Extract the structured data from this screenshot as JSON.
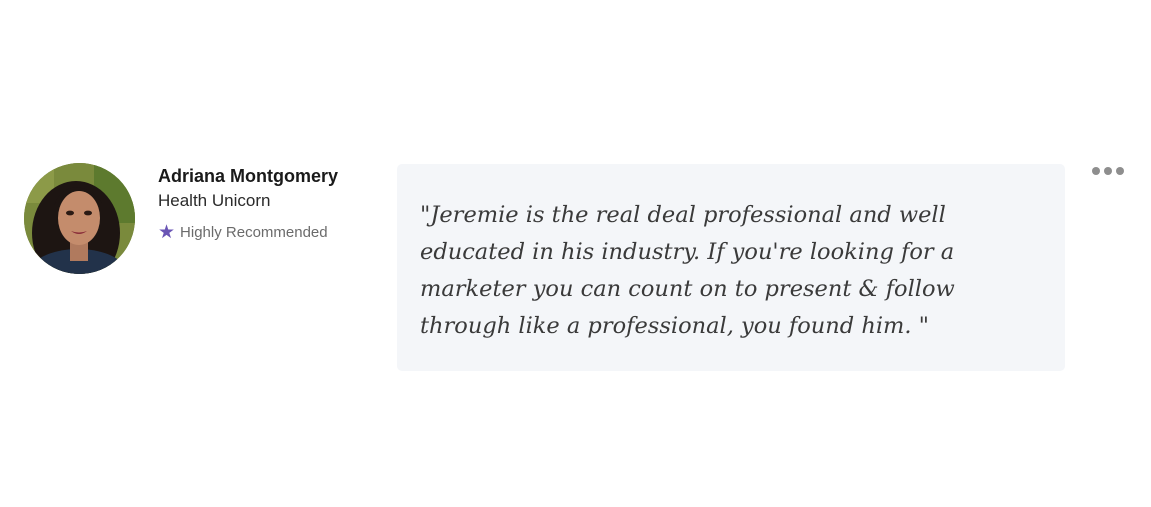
{
  "testimonial": {
    "author_name": "Adriana Montgomery",
    "author_company": "Health Unicorn",
    "badge_label": "Highly Recommended",
    "badge_icon": "star-icon",
    "quote": "\"Jeremie is the real deal professional and well educated in his industry. If you're looking for a marketer you can count on to present & follow through like a professional, you found him. \"",
    "more_icon": "more-horizontal-icon"
  },
  "colors": {
    "badge_star": "#6a55b5",
    "quote_background": "#f4f6f9",
    "more_dots": "#8e8e8e"
  }
}
